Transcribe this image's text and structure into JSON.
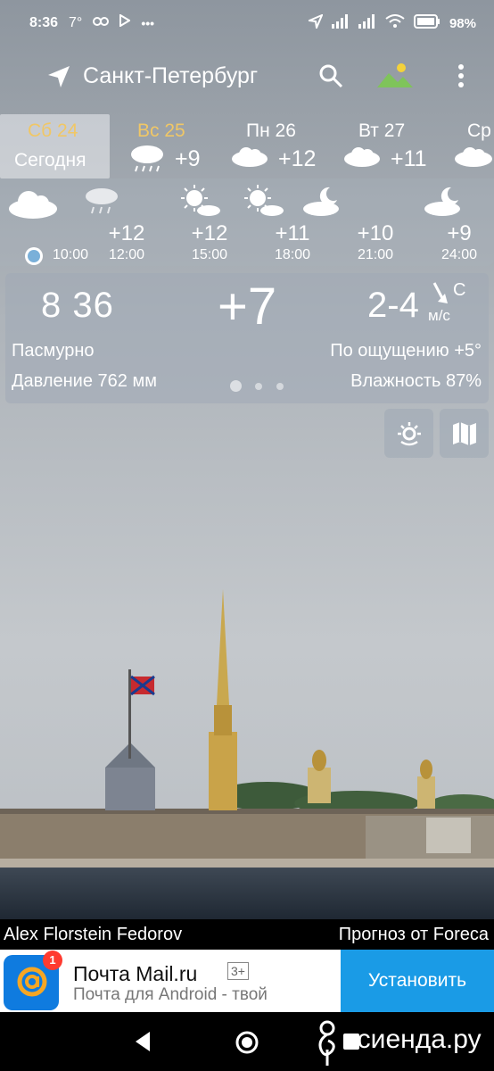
{
  "status_bar": {
    "time": "8:36",
    "temp": "7°",
    "battery": "98%"
  },
  "header": {
    "city": "Санкт-Петербург"
  },
  "days": [
    {
      "name": "Сб 24",
      "label": "Сегодня",
      "temp": "",
      "icon": "cloud-icon"
    },
    {
      "name": "Вс 25",
      "label": "",
      "temp": "+9",
      "icon": "rain-cloud-icon"
    },
    {
      "name": "Пн 26",
      "label": "",
      "temp": "+12",
      "icon": "cloud-icon"
    },
    {
      "name": "Вт 27",
      "label": "",
      "temp": "+11",
      "icon": "cloud-icon"
    },
    {
      "name": "Ср",
      "label": "",
      "temp": "",
      "icon": "cloud-icon"
    }
  ],
  "hourly": [
    {
      "time": "10:00",
      "temp": "",
      "icon": "cloud-icon",
      "current": true
    },
    {
      "time": "12:00",
      "temp": "+12",
      "icon": "rain-cloud-icon"
    },
    {
      "time": "15:00",
      "temp": "+12",
      "icon": "sun-cloud-icon"
    },
    {
      "time": "18:00",
      "temp": "+11",
      "icon": "sun-cloud-icon"
    },
    {
      "time": "21:00",
      "temp": "+10",
      "icon": "moon-cloud-icon"
    },
    {
      "time": "24:00",
      "temp": "+9",
      "icon": "moon-cloud-icon"
    }
  ],
  "current": {
    "time": "8 36",
    "temp": "+7",
    "wind": "2-4",
    "wind_dir": "С",
    "wind_unit": "м/с",
    "condition": "Пасмурно",
    "feels_like": "По ощущению +5°",
    "pressure": "Давление 762 мм",
    "humidity": "Влажность 87%"
  },
  "credits": {
    "author": "Alex Florstein Fedorov",
    "source": "Прогноз от Foreca"
  },
  "ad": {
    "badge": "1",
    "app_name": "Почта Mail.ru",
    "age": "3+",
    "description": "Почта для Android - твой",
    "install": "Установить"
  },
  "watermark": "асиенда.ру",
  "colors": {
    "accent_day": "#f0c766",
    "install_button": "#1a9be6",
    "mail_logo": "#0f7bdf",
    "badge": "#ff3b30"
  }
}
